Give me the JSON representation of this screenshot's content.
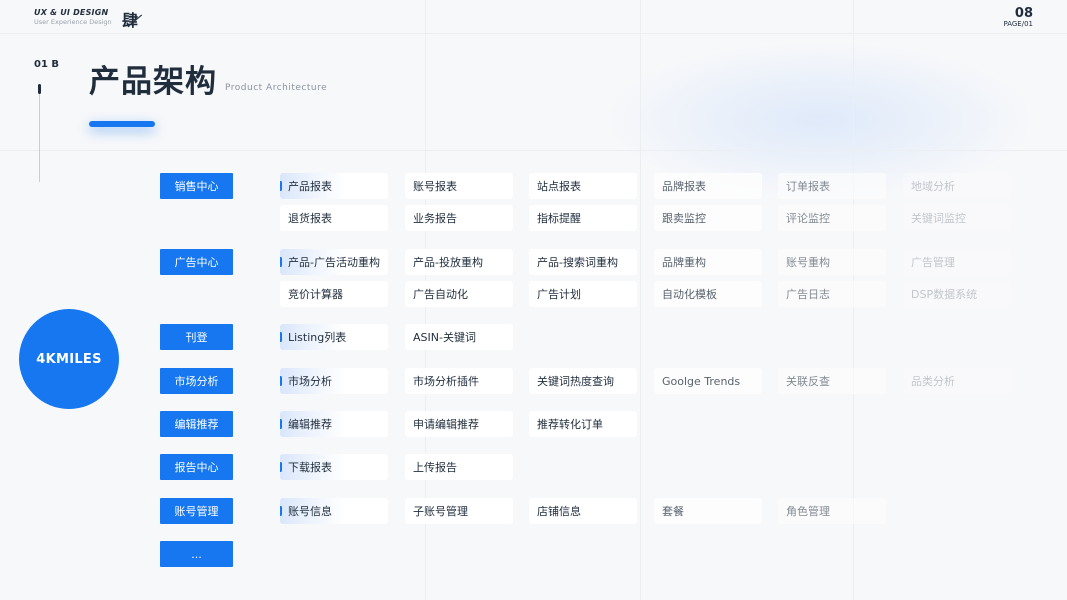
{
  "header": {
    "brand_title": "UX & UI DESIGN",
    "brand_subtitle": "User Experience Design",
    "brand_mark": "肆",
    "page_number": "08",
    "page_label": "PAGE/01"
  },
  "section": {
    "index": "01 B",
    "title": "产品架构",
    "subtitle": "Product Architecture"
  },
  "hub": {
    "label": "4KMILES"
  },
  "colors": {
    "accent": "#1677f0",
    "text": "#1f2d3d",
    "muted": "#8a94a0"
  },
  "categories": [
    {
      "label": "销售中心",
      "rows": [
        [
          "产品报表",
          "账号报表",
          "站点报表",
          "品牌报表",
          "订单报表",
          "地域分析"
        ],
        [
          "退货报表",
          "业务报告",
          "指标提醒",
          "跟卖监控",
          "评论监控",
          "关键词监控"
        ]
      ]
    },
    {
      "label": "广告中心",
      "rows": [
        [
          "产品-广告活动重构",
          "产品-投放重构",
          "产品-搜索词重构",
          "品牌重构",
          "账号重构",
          "广告管理"
        ],
        [
          "竞价计算器",
          "广告自动化",
          "广告计划",
          "自动化模板",
          "广告日志",
          "DSP数据系统"
        ]
      ]
    },
    {
      "label": "刊登",
      "rows": [
        [
          "Listing列表",
          "ASIN-关键词"
        ]
      ]
    },
    {
      "label": "市场分析",
      "rows": [
        [
          "市场分析",
          "市场分析插件",
          "关键词热度查询",
          "Goolge Trends",
          "关联反查",
          "品类分析"
        ]
      ]
    },
    {
      "label": "编辑推荐",
      "rows": [
        [
          "编辑推荐",
          "申请编辑推荐",
          "推荐转化订单"
        ]
      ]
    },
    {
      "label": "报告中心",
      "rows": [
        [
          "下载报表",
          "上传报告"
        ]
      ]
    },
    {
      "label": "账号管理",
      "rows": [
        [
          "账号信息",
          "子账号管理",
          "店铺信息",
          "套餐",
          "角色管理"
        ]
      ]
    },
    {
      "label": "...",
      "rows": []
    }
  ]
}
